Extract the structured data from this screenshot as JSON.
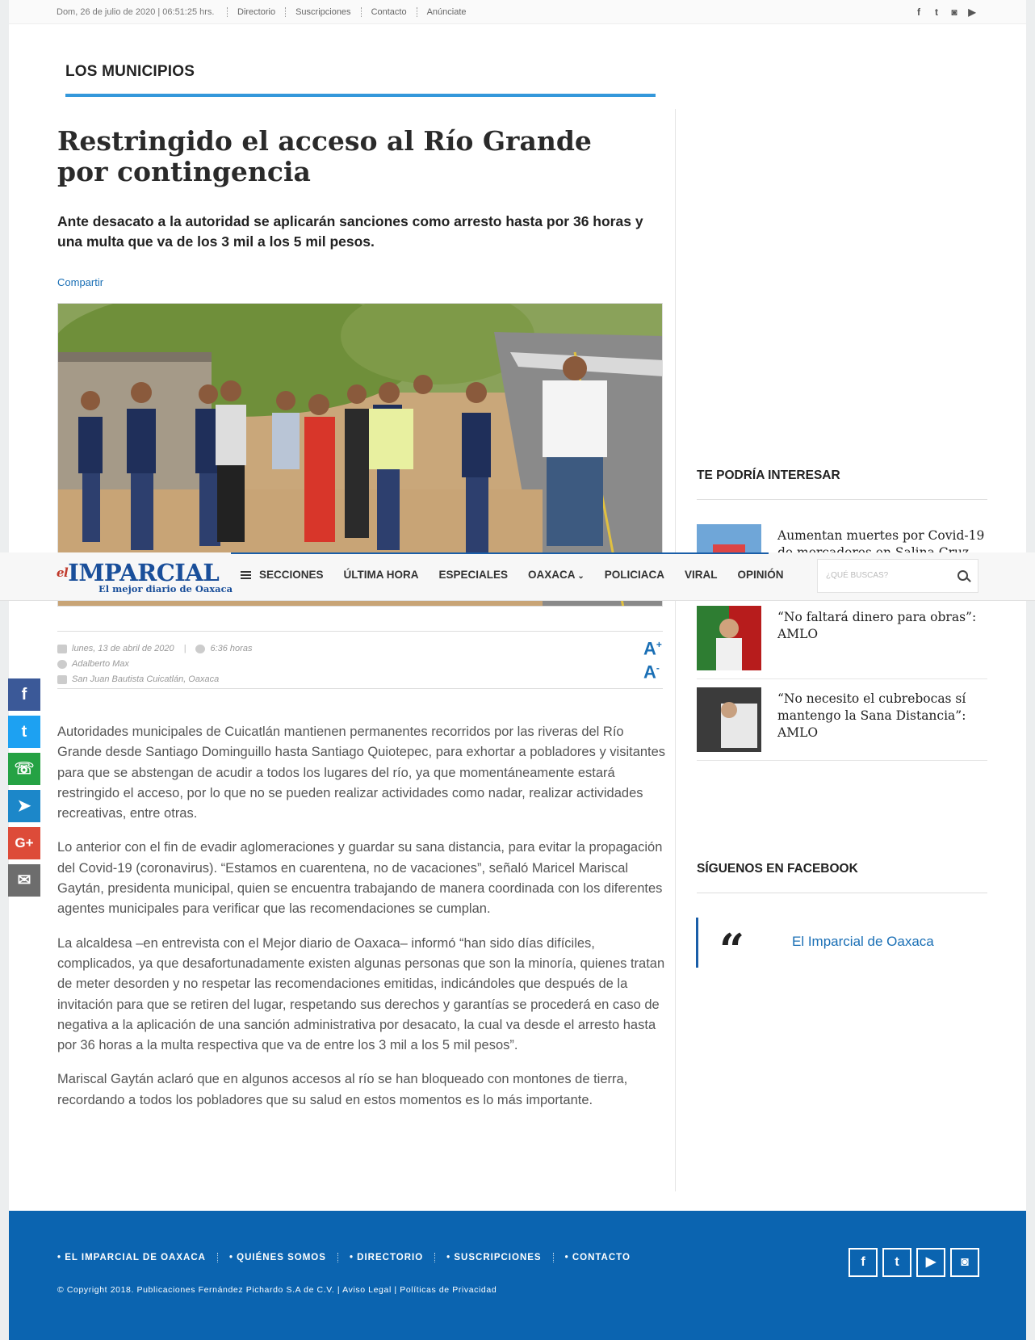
{
  "topbar": {
    "date": "Dom, 26 de julio de 2020 | 06:51:25 hrs.",
    "links": [
      "Directorio",
      "Suscripciones",
      "Contacto",
      "Anúnciate"
    ]
  },
  "section": {
    "title": "LOS MUNICIPIOS"
  },
  "article": {
    "headline": "Restringido el acceso al Río Grande por contingencia",
    "deck": "Ante desacato a la autoridad se aplicarán sanciones como arresto hasta por 36 horas y una multa que va de los 3 mil a los 5 mil pesos.",
    "share_label": "Compartir",
    "date": "lunes, 13 de abril de 2020",
    "time": "6:36 horas",
    "author": "Adalberto Max",
    "location": "San Juan Bautista Cuicatlán, Oaxaca",
    "font_plus": "A",
    "font_minus": "A",
    "paragraphs": [
      "Autoridades municipales de Cuicatlán mantienen permanentes recorridos por las riveras del Río Grande desde Santiago Dominguillo hasta Santiago Quiotepec, para exhortar a pobladores y visitantes para que se abstengan de acudir a todos los lugares del río, ya que momentáneamente estará restringido el acceso, por lo que no se pueden realizar actividades como nadar, realizar actividades recreativas, entre otras.",
      "Lo anterior con el fin de evadir aglomeraciones y guardar su sana distancia, para evitar la propagación del Covid-19 (coronavirus). “Estamos en cuarentena, no de vacaciones”, señaló Maricel Mariscal Gaytán, presidenta municipal, quien se encuentra trabajando de manera coordinada con los diferentes agentes municipales para verificar que las recomendaciones se cumplan.",
      "La alcaldesa –en entrevista con el Mejor diario de Oaxaca– informó “han sido días difíciles, complicados, ya que desafortunadamente existen algunas personas que son la minoría, quienes tratan de meter desorden y no respetar las recomendaciones emitidas, indicándoles que después de la invitación para que se retiren del lugar, respetando sus derechos y garantías se procederá en caso de negativa a la aplicación de una sanción administrativa por desacato, la cual va desde el arresto hasta por 36 horas a la multa respectiva que va de entre los 3 mil a los 5 mil pesos”.",
      "Mariscal Gaytán aclaró que en algunos accesos al río se han bloqueado con montones de tierra, recordando a todos los pobladores que su salud en estos momentos es lo más importante."
    ]
  },
  "share_rail": [
    {
      "icon": "facebook-icon",
      "glyph": "f",
      "color": "#3b5998"
    },
    {
      "icon": "twitter-icon",
      "glyph": "t",
      "color": "#1da1f2"
    },
    {
      "icon": "whatsapp-icon",
      "glyph": "w",
      "color": "#25a244"
    },
    {
      "icon": "telegram-icon",
      "glyph": "➤",
      "color": "#1c87c9"
    },
    {
      "icon": "google-plus-icon",
      "glyph": "G+",
      "color": "#dd4b39"
    },
    {
      "icon": "mail-icon",
      "glyph": "✉",
      "color": "#6d6d6d"
    }
  ],
  "nav": {
    "logo_el": "el",
    "logo_name": "IMPARCIAL",
    "logo_tag": "El mejor diario de Oaxaca",
    "sections_label": "SECCIONES",
    "items": [
      "ÚLTIMA HORA",
      "ESPECIALES",
      "OAXACA",
      "POLICIACA",
      "VIRAL",
      "OPINIÓN"
    ],
    "search_placeholder": "¿QUÉ BUSCAS?"
  },
  "sidebar": {
    "interest_title": "TE PODRÍA INTERESAR",
    "stories": [
      "Aumentan muertes por Covid-19 de mercaderes en Salina Cruz",
      "“No faltará dinero para obras”: AMLO",
      "“No necesito el cubrebocas sí mantengo la Sana Distancia”: AMLO"
    ],
    "facebook_title": "SÍGUENOS EN FACEBOOK",
    "facebook_page": "El Imparcial de Oaxaca"
  },
  "footer": {
    "links": [
      "• EL IMPARCIAL DE OAXACA",
      "• QUIÉNES SOMOS",
      "• DIRECTORIO",
      "• SUSCRIPCIONES",
      "• CONTACTO"
    ],
    "copyright": "© Copyright 2018. Publicaciones Fernández Pichardo S.A de C.V. | Aviso Legal | Políticas de Privacidad"
  },
  "colors": {
    "accent": "#1a6fb5",
    "footer_bg": "#0b64b0",
    "section_rule": "#3498db"
  }
}
